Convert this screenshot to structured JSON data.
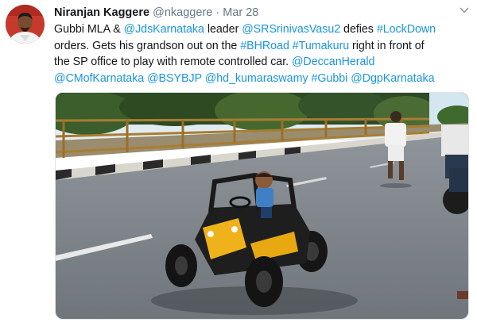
{
  "tweet": {
    "author_name": "Niranjan Kaggere",
    "handle": "@nkaggere",
    "separator": "·",
    "date": "Mar 28",
    "lines": [
      [
        {
          "t": "Gubbi MLA & ",
          "k": "text"
        },
        {
          "t": "@JdsKarnataka",
          "k": "mention"
        },
        {
          "t": " leader ",
          "k": "text"
        },
        {
          "t": "@SRSrinivasVasu2",
          "k": "mention"
        },
        {
          "t": " defies ",
          "k": "text"
        },
        {
          "t": "#LockDown",
          "k": "hashtag"
        }
      ],
      [
        {
          "t": " orders. Gets his grandson out on the ",
          "k": "text"
        },
        {
          "t": "#BHRoad",
          "k": "hashtag"
        },
        {
          "t": " ",
          "k": "text"
        },
        {
          "t": "#Tumakuru",
          "k": "hashtag"
        },
        {
          "t": " right in front of",
          "k": "text"
        }
      ],
      [
        {
          "t": "the SP office to play with remote controlled car. ",
          "k": "text"
        },
        {
          "t": "@DeccanHerald",
          "k": "mention"
        }
      ],
      [
        {
          "t": "@CMofKarnataka",
          "k": "mention"
        },
        {
          "t": " ",
          "k": "text"
        },
        {
          "t": "@BSYBJP",
          "k": "mention"
        },
        {
          "t": " ",
          "k": "text"
        },
        {
          "t": "@hd_kumaraswamy",
          "k": "mention"
        },
        {
          "t": " ",
          "k": "text"
        },
        {
          "t": "#Gubbi",
          "k": "hashtag"
        },
        {
          "t": " ",
          "k": "text"
        },
        {
          "t": "@DgpKarnataka",
          "k": "mention"
        }
      ]
    ]
  },
  "colors": {
    "link": "#1b95e0",
    "secondary_text": "#657786",
    "primary_text": "#14171a"
  },
  "icons": {
    "menu": "chevron-down-icon"
  }
}
